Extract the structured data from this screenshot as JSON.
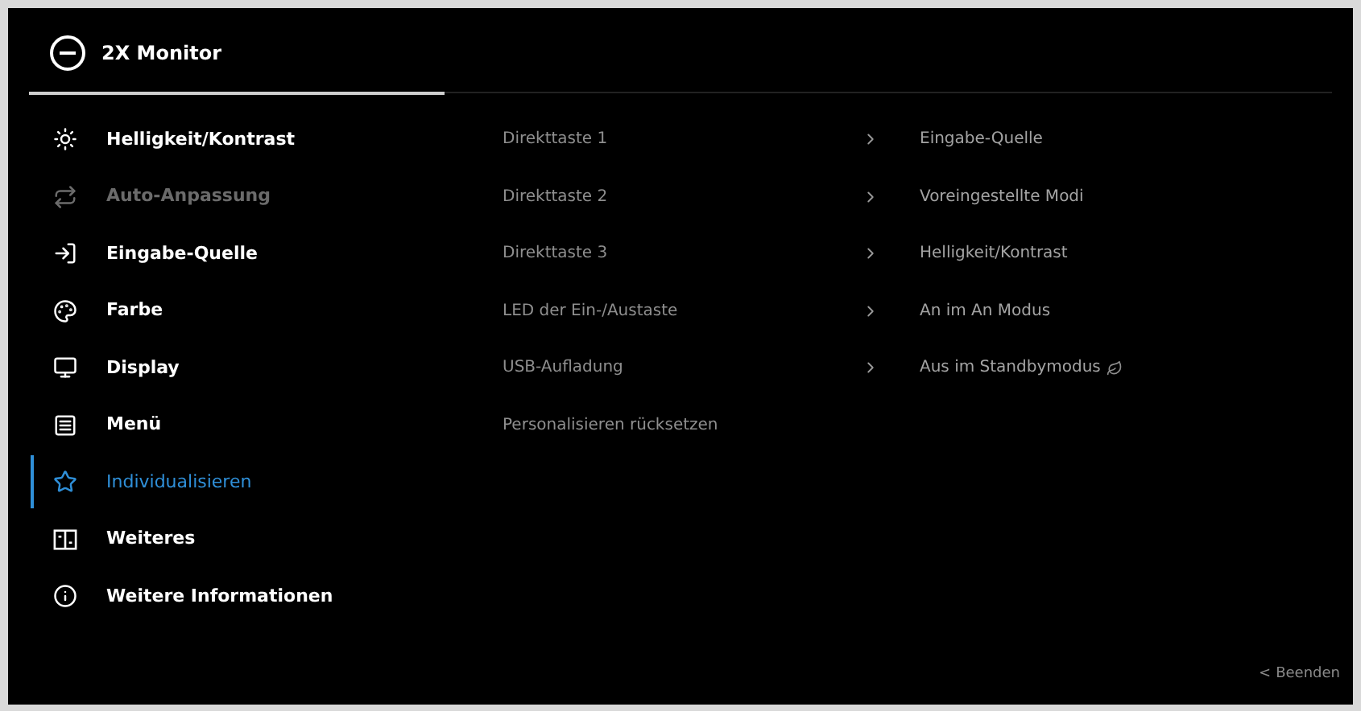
{
  "header": {
    "title": "2X Monitor"
  },
  "sidebar": {
    "items": [
      {
        "label": "Helligkeit/Kontrast",
        "selected": false,
        "disabled": false
      },
      {
        "label": "Auto-Anpassung",
        "selected": false,
        "disabled": true
      },
      {
        "label": "Eingabe-Quelle",
        "selected": false,
        "disabled": false
      },
      {
        "label": "Farbe",
        "selected": false,
        "disabled": false
      },
      {
        "label": "Display",
        "selected": false,
        "disabled": false
      },
      {
        "label": "Menü",
        "selected": false,
        "disabled": false
      },
      {
        "label": "Individualisieren",
        "selected": true,
        "disabled": false
      },
      {
        "label": "Weiteres",
        "selected": false,
        "disabled": false
      },
      {
        "label": "Weitere Informationen",
        "selected": false,
        "disabled": false
      }
    ]
  },
  "settings": [
    {
      "label": "Direkttaste 1",
      "kind": "submenu",
      "value": "Eingabe-Quelle",
      "eco": false
    },
    {
      "label": "Direkttaste 2",
      "kind": "submenu",
      "value": "Voreingestellte Modi",
      "eco": false
    },
    {
      "label": "Direkttaste 3",
      "kind": "submenu",
      "value": "Helligkeit/Kontrast",
      "eco": false
    },
    {
      "label": "LED der Ein-/Austaste",
      "kind": "submenu",
      "value": "An im An Modus",
      "eco": false
    },
    {
      "label": "USB-Aufladung",
      "kind": "submenu",
      "value": "Aus im Standbymodus",
      "eco": true
    },
    {
      "label": "Personalisieren rücksetzen",
      "kind": "action"
    }
  ],
  "footer": {
    "exit_arrow": "<",
    "exit_label": "Beenden"
  }
}
